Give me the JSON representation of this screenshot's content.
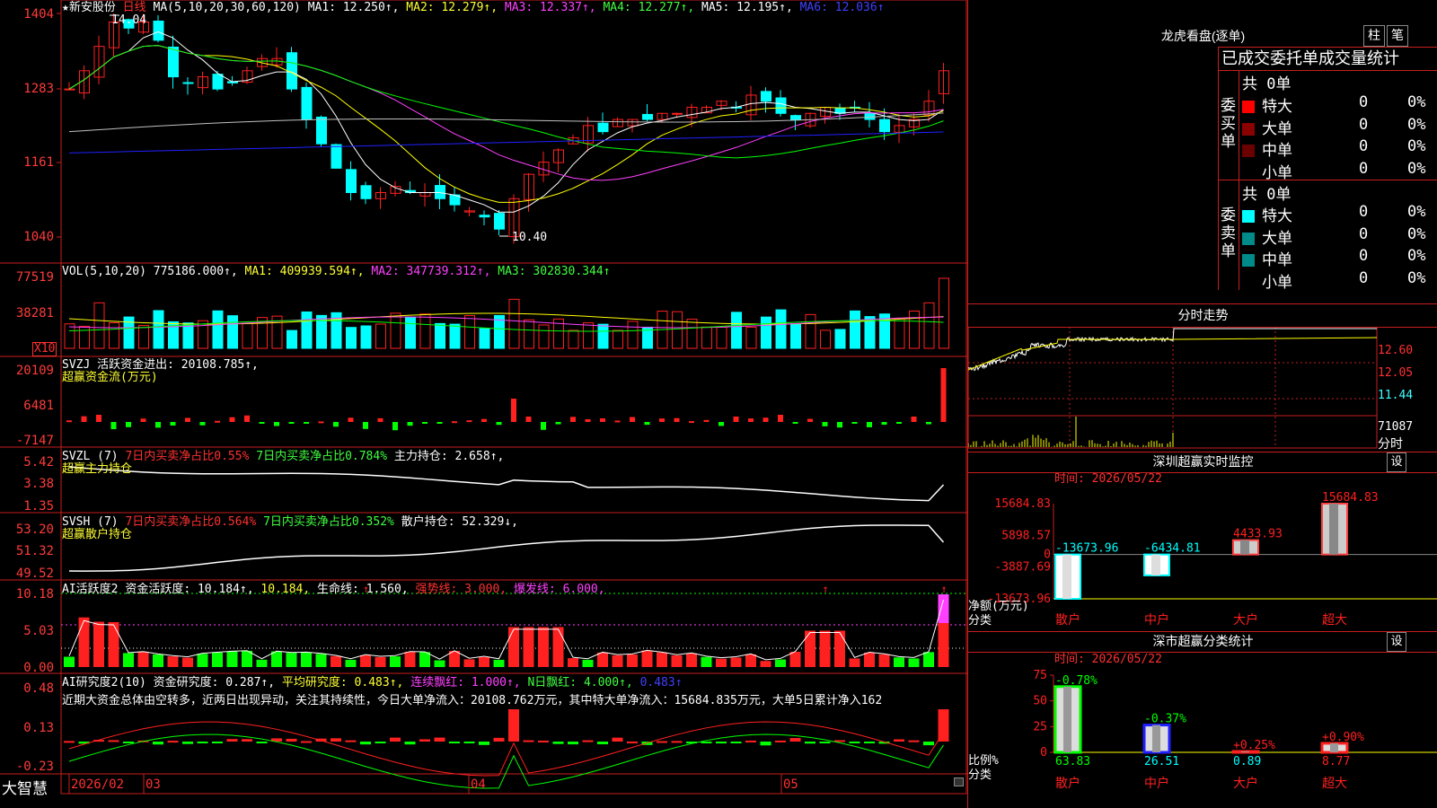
{
  "colors": {
    "red": "#ff3030",
    "cyan": "#00ffff",
    "green": "#00ff00",
    "yellow": "#ffff00",
    "magenta": "#ff40ff",
    "white": "#ffffff",
    "grid": "#c81e1e"
  },
  "main_panel": {
    "star": "★",
    "stock_name": "新安股份",
    "period": "日线",
    "ma_params": "MA(5,10,20,30,60,120)",
    "ma1": "MA1: 12.250↑,",
    "ma2": "MA2: 12.279↑,",
    "ma3": "MA3: 12.337↑,",
    "ma4": "MA4: 12.277↑,",
    "ma5": "MA5: 12.195↑,",
    "ma6": "MA6: 12.036↑",
    "y_ticks": [
      "1404",
      "1283",
      "1161",
      "1040"
    ],
    "high_label": "14.04",
    "low_label": "10.40"
  },
  "vol_panel": {
    "title": "VOL(5,10,20)",
    "value": "775186.000↑,",
    "ma1": "MA1: 409939.594↑,",
    "ma2": "MA2: 347739.312↑,",
    "ma3": "MA3: 302830.344↑",
    "y_ticks": [
      "77519",
      "38281"
    ],
    "unit": "X10"
  },
  "svzj_panel": {
    "title": "SVZJ  活跃资金进出: 20108.785↑,",
    "subtitle": "超赢资金流(万元)",
    "y_ticks": [
      "20109",
      "6481",
      "-7147"
    ]
  },
  "svzl_panel": {
    "name": "SVZL (7)",
    "buy_ratio": "7日内买卖净占比0.55%",
    "buy_ratio2": "7日内买卖净占比0.784%",
    "holding": "主力持仓: 2.658↑,",
    "subtitle": "超赢主力持仓",
    "y_ticks": [
      "5.42",
      "3.38",
      "1.35"
    ]
  },
  "svsh_panel": {
    "name": "SVSH (7)",
    "buy_ratio": "7日内买卖净占比0.564%",
    "buy_ratio2": "7日内买卖净占比0.352%",
    "holding": "散户持仓: 52.329↓,",
    "subtitle": "超赢散户持仓",
    "y_ticks": [
      "53.20",
      "51.32",
      "49.52"
    ]
  },
  "ai2_panel": {
    "name": "AI活跃度2",
    "active": "资金活跃度: 10.184↑,",
    "val2": "10.184,",
    "life": "生命线: 1.560,",
    "strong": "强势线: 3.000,",
    "burst": "爆发线: 6.000,",
    "y_ticks": [
      "10.18",
      "5.03",
      "0.00"
    ]
  },
  "ai_research_panel": {
    "name": "AI研究度2(10)",
    "research": "资金研究度: 0.287↑,",
    "avg": "平均研究度: 0.483↑,",
    "consec": "连续飘红: 1.000↑,",
    "nday": "N日飘红: 4.000↑,",
    "v483": "0.483↑",
    "comment": "近期大资金总体由空转多，近两日出现异动，关注其持续性，今日大单净流入：20108.762万元，其中特大单净流入：15684.835万元，大单5日累计净入162",
    "y_ticks": [
      "0.48",
      "0.13",
      "-0.23"
    ]
  },
  "bottom_axis": {
    "brand": "大智慧",
    "dates": [
      "2026/02",
      "03",
      "04",
      "05"
    ]
  },
  "dragon_tiger": {
    "title": "龙虎看盘(逐单)",
    "btn_bar": "柱",
    "btn_pen": "笔",
    "header": "已成交委托单成交量统计",
    "buy": {
      "total": "共 0单",
      "label": "委买单",
      "rows": [
        {
          "name": "特大",
          "count": "0",
          "pct": "0%",
          "color": "#ff0000"
        },
        {
          "name": "大单",
          "count": "0",
          "pct": "0%",
          "color": "#8b0000"
        },
        {
          "name": "中单",
          "count": "0",
          "pct": "0%",
          "color": "#6b0000"
        },
        {
          "name": "小单",
          "count": "0",
          "pct": "0%",
          "color": ""
        }
      ]
    },
    "sell": {
      "total": "共 0单",
      "label": "委卖单",
      "rows": [
        {
          "name": "特大",
          "count": "0",
          "pct": "0%",
          "color": "#00ffff"
        },
        {
          "name": "大单",
          "count": "0",
          "pct": "0%",
          "color": "#008b8b"
        },
        {
          "name": "中单",
          "count": "0",
          "pct": "0%",
          "color": "#008b8b"
        },
        {
          "name": "小单",
          "count": "0",
          "pct": "0%",
          "color": ""
        }
      ]
    }
  },
  "intraday": {
    "title": "分时走势",
    "y_ticks": [
      "12.60",
      "12.05",
      "11.44"
    ],
    "vol_label": "71087",
    "corner": "分时"
  },
  "sz_monitor": {
    "title": "深圳超赢实时监控",
    "settings": "设",
    "time": "时间: 2026/05/22",
    "y_ticks": [
      "15684.83",
      "5898.57",
      "0",
      "-3887.69",
      "-13673.96"
    ],
    "unit_label": "净额(万元)",
    "cat_label": "分类",
    "categories": [
      "散户",
      "中户",
      "大户",
      "超大"
    ],
    "values": [
      -13673.96,
      -6434.81,
      4433.93,
      15684.83
    ],
    "value_labels": [
      "-13673.96",
      "-6434.81",
      "4433.93",
      "15684.83"
    ]
  },
  "sz_class": {
    "title": "深市超赢分类统计",
    "settings": "设",
    "time": "时间: 2026/05/22",
    "y_ticks": [
      "75",
      "50",
      "25",
      "0"
    ],
    "unit_label": "比例%",
    "cat_label": "分类",
    "categories": [
      "散户",
      "中户",
      "大户",
      "超大"
    ],
    "values": [
      63.83,
      26.51,
      0.89,
      8.77
    ],
    "value_labels": [
      "63.83",
      "26.51",
      "0.89",
      "8.77"
    ],
    "change_labels": [
      "-0.78%",
      "-0.37%",
      "+0.25%",
      "+0.90%"
    ]
  }
}
